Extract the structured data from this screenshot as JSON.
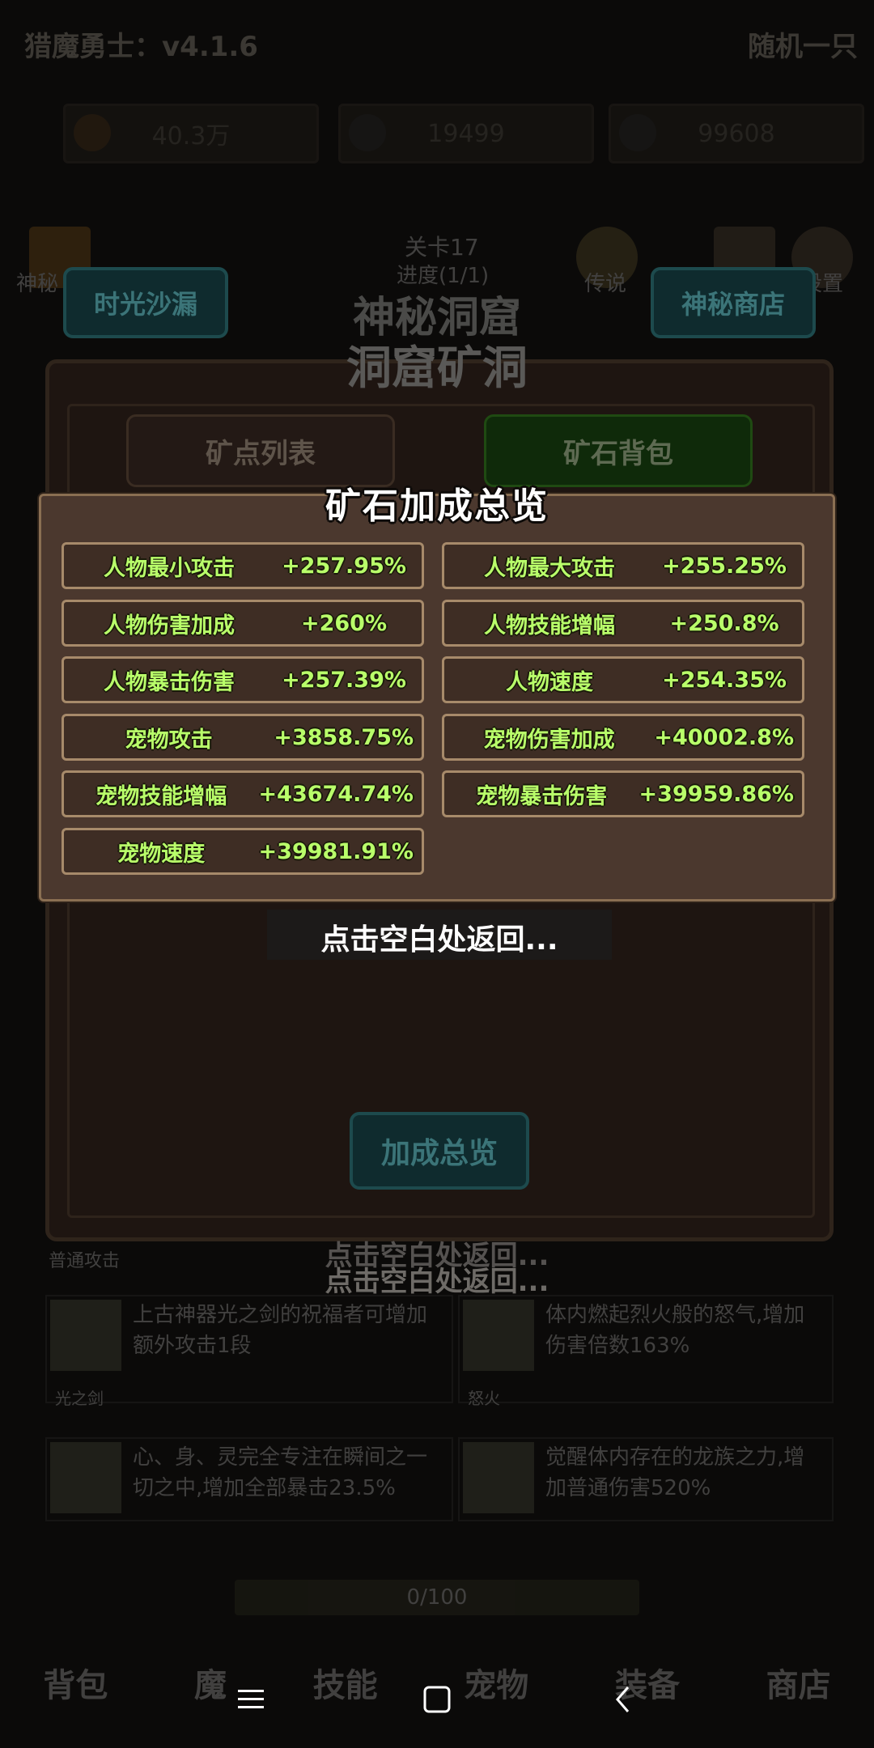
{
  "hud": {
    "version_text": "猎魔勇士：v4.1.6",
    "player_name": "随机一只",
    "gold": "40.3万",
    "gems": "19499",
    "energy": "99608",
    "stage_text": "关卡17",
    "progress_text": "进度(1/1)",
    "left_icon_label": "神秘",
    "mid_icon_label": "传说",
    "right_icon_label": "设置"
  },
  "background": {
    "title_back": "神秘洞窟",
    "title_front": "洞窟矿洞",
    "btn_hourglass": "时光沙漏",
    "btn_shop": "神秘商店",
    "tab_mine_list": "矿点列表",
    "tab_ore_bag": "矿石背包",
    "bonus_button": "加成总览",
    "hint_behind_1": "点击空白处返回...",
    "hint_behind_2": "点击空白处返回...",
    "small_label": "普通攻击",
    "skill1_text": "上古神器光之剑的祝福者可增加额外攻击1段",
    "skill1_name": "光之剑",
    "skill2_text": "体内燃起烈火般的怒气,增加伤害倍数163%",
    "skill2_name": "怒火",
    "skill3_text": "心、身、灵完全专注在瞬间之一切之中,增加全部暴击23.5%",
    "skill4_text": "觉醒体内存在的龙族之力,增加普通伤害520%",
    "progress_bar_text": "0/100",
    "tabs": [
      "背包",
      "魔",
      "技能",
      "宠物",
      "装备",
      "商店"
    ]
  },
  "popup": {
    "title": "矿石加成总览",
    "stats": [
      {
        "name": "人物最小攻击",
        "value": "+257.95%"
      },
      {
        "name": "人物最大攻击",
        "value": "+255.25%"
      },
      {
        "name": "人物伤害加成",
        "value": "+260%"
      },
      {
        "name": "人物技能增幅",
        "value": "+250.8%"
      },
      {
        "name": "人物暴击伤害",
        "value": "+257.39%"
      },
      {
        "name": "人物速度",
        "value": "+254.35%"
      },
      {
        "name": "宠物攻击",
        "value": "+3858.75%"
      },
      {
        "name": "宠物伤害加成",
        "value": "+40002.8%"
      },
      {
        "name": "宠物技能增幅",
        "value": "+43674.74%"
      },
      {
        "name": "宠物暴击伤害",
        "value": "+39959.86%"
      },
      {
        "name": "宠物速度",
        "value": "+39981.91%"
      }
    ],
    "hint": "点击空白处返回..."
  },
  "system_nav": {
    "menu_icon": "menu-icon",
    "home_icon": "home-icon",
    "back_icon": "back-icon"
  }
}
